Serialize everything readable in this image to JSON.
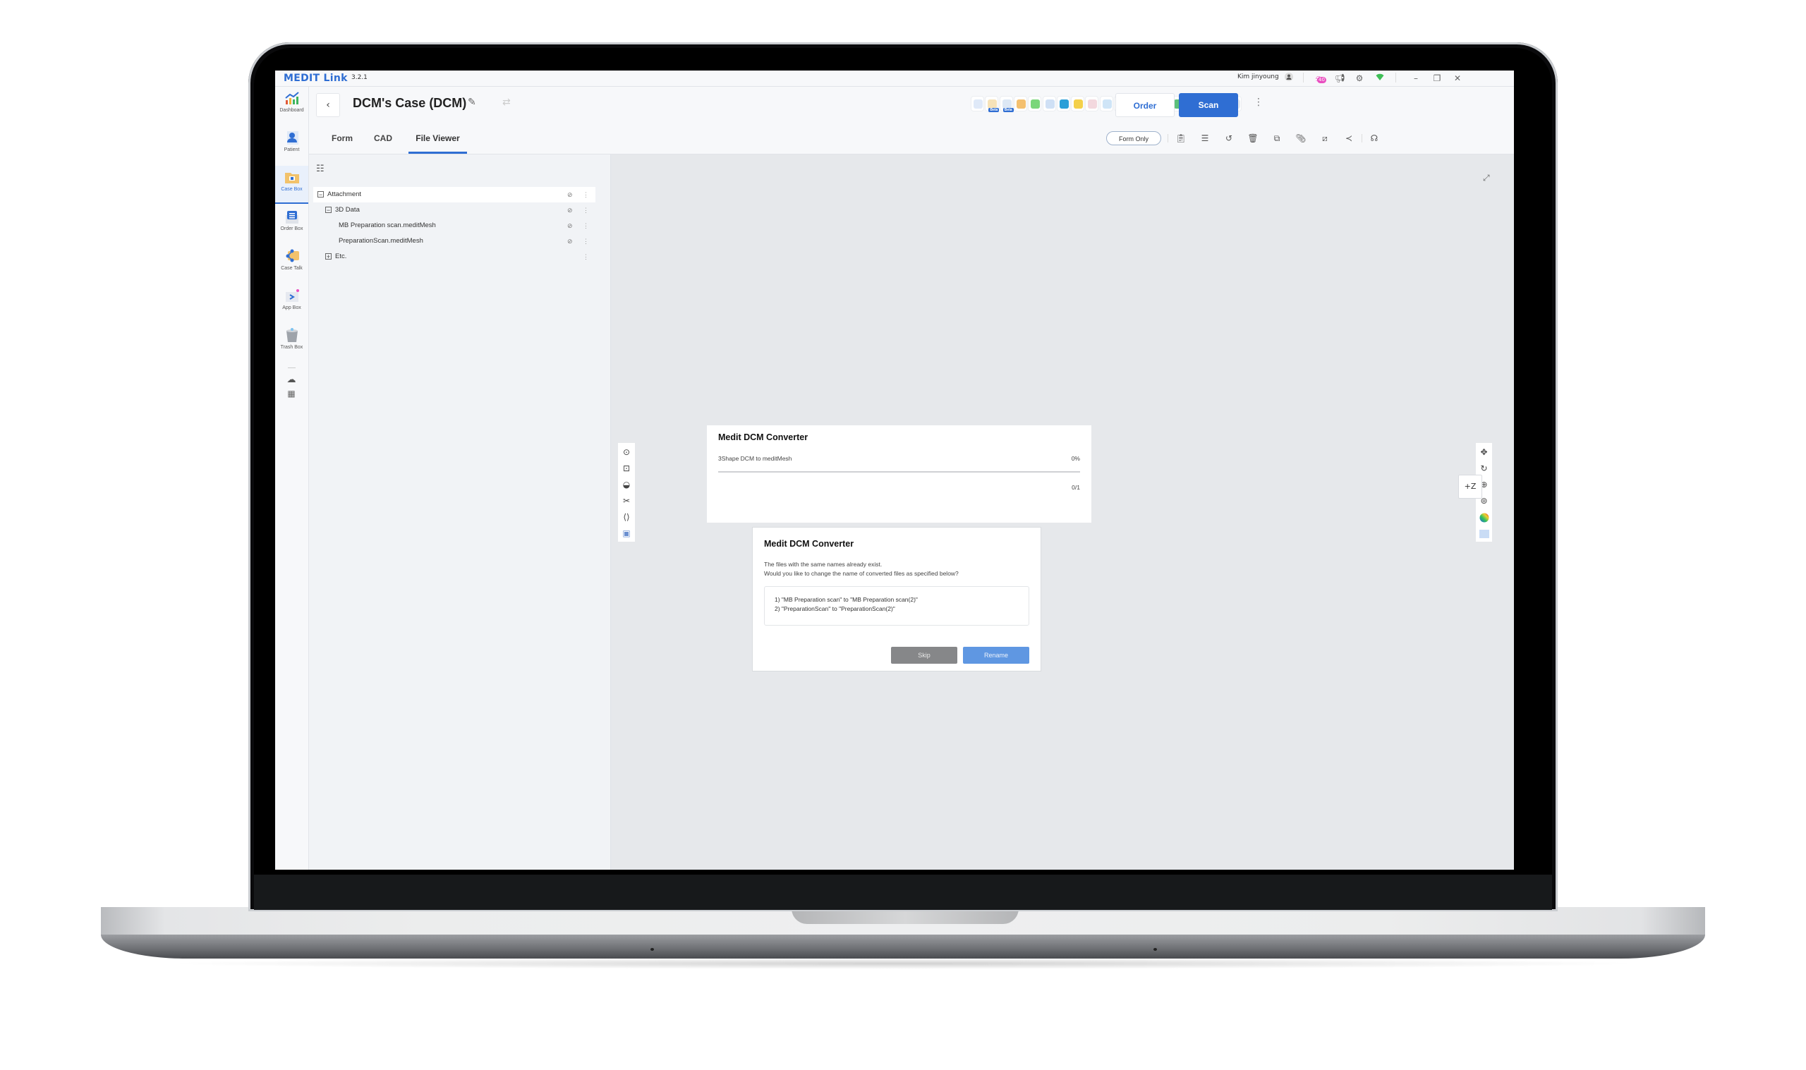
{
  "titlebar": {
    "app_name": "MEDIT Link",
    "version": "3.2.1",
    "user_name": "Kim jinyoung",
    "notification_count": "40",
    "icons": [
      "user-icon",
      "notification-bell-icon",
      "announcement-megaphone-icon",
      "settings-gear-icon",
      "wifi-icon",
      "minimize-icon",
      "restore-icon",
      "close-icon"
    ]
  },
  "sidebar": {
    "items": [
      {
        "label": "Dashboard",
        "icon": "dashboard-chart-icon",
        "active": false
      },
      {
        "label": "Patient",
        "icon": "patient-icon",
        "active": false
      },
      {
        "label": "Case Box",
        "icon": "case-box-icon",
        "active": true
      },
      {
        "label": "Order Box",
        "icon": "order-box-icon",
        "active": false
      },
      {
        "label": "Case Talk",
        "icon": "case-talk-icon",
        "active": false
      },
      {
        "label": "App Box",
        "icon": "app-box-icon",
        "active": false
      },
      {
        "label": "Trash Box",
        "icon": "trash-box-icon",
        "active": false
      }
    ],
    "bottom_icons": [
      "cloud-sync-icon",
      "apps-grid-icon"
    ]
  },
  "header": {
    "back_symbol": "‹",
    "case_title": "DCM's Case (DCM)",
    "tabs": [
      {
        "label": "Form",
        "active": false
      },
      {
        "label": "CAD",
        "active": false
      },
      {
        "label": "File Viewer",
        "active": true
      }
    ],
    "app_icons": [
      {
        "name": "model-builder-app-icon",
        "beta": false
      },
      {
        "name": "crown-fit-app-icon",
        "beta": true,
        "badge": "Beta"
      },
      {
        "name": "smile-design-app-icon",
        "beta": true,
        "badge": "Beta"
      },
      {
        "name": "clinic-circles-app-icon",
        "beta": false
      },
      {
        "name": "ortho-simulation-app-icon",
        "beta": false
      },
      {
        "name": "dcm-converter-app-icon",
        "beta": false
      },
      {
        "name": "stripes-app-icon",
        "beta": false
      },
      {
        "name": "design-kit-app-icon",
        "beta": false
      },
      {
        "name": "splint-app-icon",
        "beta": false
      },
      {
        "name": "millbox-app-icon",
        "beta": false
      },
      {
        "name": "model-app-icon",
        "beta": false
      },
      {
        "name": "implant-app-icon",
        "beta": false
      },
      {
        "name": "teeth-app-icon",
        "beta": false
      },
      {
        "name": "p-logo-app-icon",
        "beta": false
      },
      {
        "name": "heatmap-app-icon",
        "beta": false
      },
      {
        "name": "cloud-red-app-icon",
        "beta": false
      },
      {
        "name": "lips-app-icon",
        "beta": false
      },
      {
        "name": "aligner-app-icon",
        "beta": false
      },
      {
        "name": "ortho-bracket-app-icon",
        "beta": false
      }
    ],
    "order_label": "Order",
    "scan_label": "Scan",
    "form_only_label": "Form Only",
    "action_icons": [
      "clipboard-info-icon",
      "notes-icon",
      "history-icon",
      "delete-icon",
      "copy-icon",
      "attachment-icon",
      "edit-box-icon",
      "share-icon",
      "headset-icon"
    ]
  },
  "file_tree": {
    "toggle_icon": "tree-view-icon",
    "rows": [
      {
        "label": "Attachment",
        "toggle": "−",
        "level": 0,
        "selected": true,
        "has_eye": true
      },
      {
        "label": "3D Data",
        "toggle": "−",
        "level": 1,
        "selected": false,
        "has_eye": true
      },
      {
        "label": "MB Preparation scan.meditMesh",
        "toggle": "",
        "level": 2,
        "selected": false,
        "has_eye": true
      },
      {
        "label": "PreparationScan.meditMesh",
        "toggle": "",
        "level": 2,
        "selected": false,
        "has_eye": true
      },
      {
        "label": "Etc.",
        "toggle": "+",
        "level": 1,
        "selected": false,
        "has_eye": false
      }
    ]
  },
  "viewer": {
    "left_tools": [
      "capture-icon",
      "area-capture-icon",
      "half-circle-icon",
      "scissors-icon",
      "bracket-measure-icon",
      "screenshot-icon"
    ],
    "right_tools": [
      "move-icon",
      "rotate-icon",
      "zoom-in-icon",
      "zoom-fit-icon",
      "color-map-icon",
      "view-cube-icon"
    ],
    "z_button_label": "+Z"
  },
  "progress_dialog": {
    "title": "Medit DCM Converter",
    "task_label": "3Shape DCM to meditMesh",
    "percent_text": "0%",
    "progress": 0,
    "count_text": "0/1"
  },
  "rename_dialog": {
    "title": "Medit DCM Converter",
    "message_line1": "The files with the same names already exist.",
    "message_line2": "Would you like to change the name of converted files as specified below?",
    "items": [
      "1) \"MB Preparation scan\" to \"MB Preparation scan(2)\"",
      "2) \"PreparationScan\" to \"PreparationScan(2)\""
    ],
    "skip_label": "Skip",
    "rename_label": "Rename"
  },
  "colors": {
    "accent": "#2f6ed3",
    "rename_button": "#5f97e2",
    "skip_button": "#868789",
    "viewer_background": "#e6e8eb",
    "notification_badge": "#e94ec0"
  }
}
